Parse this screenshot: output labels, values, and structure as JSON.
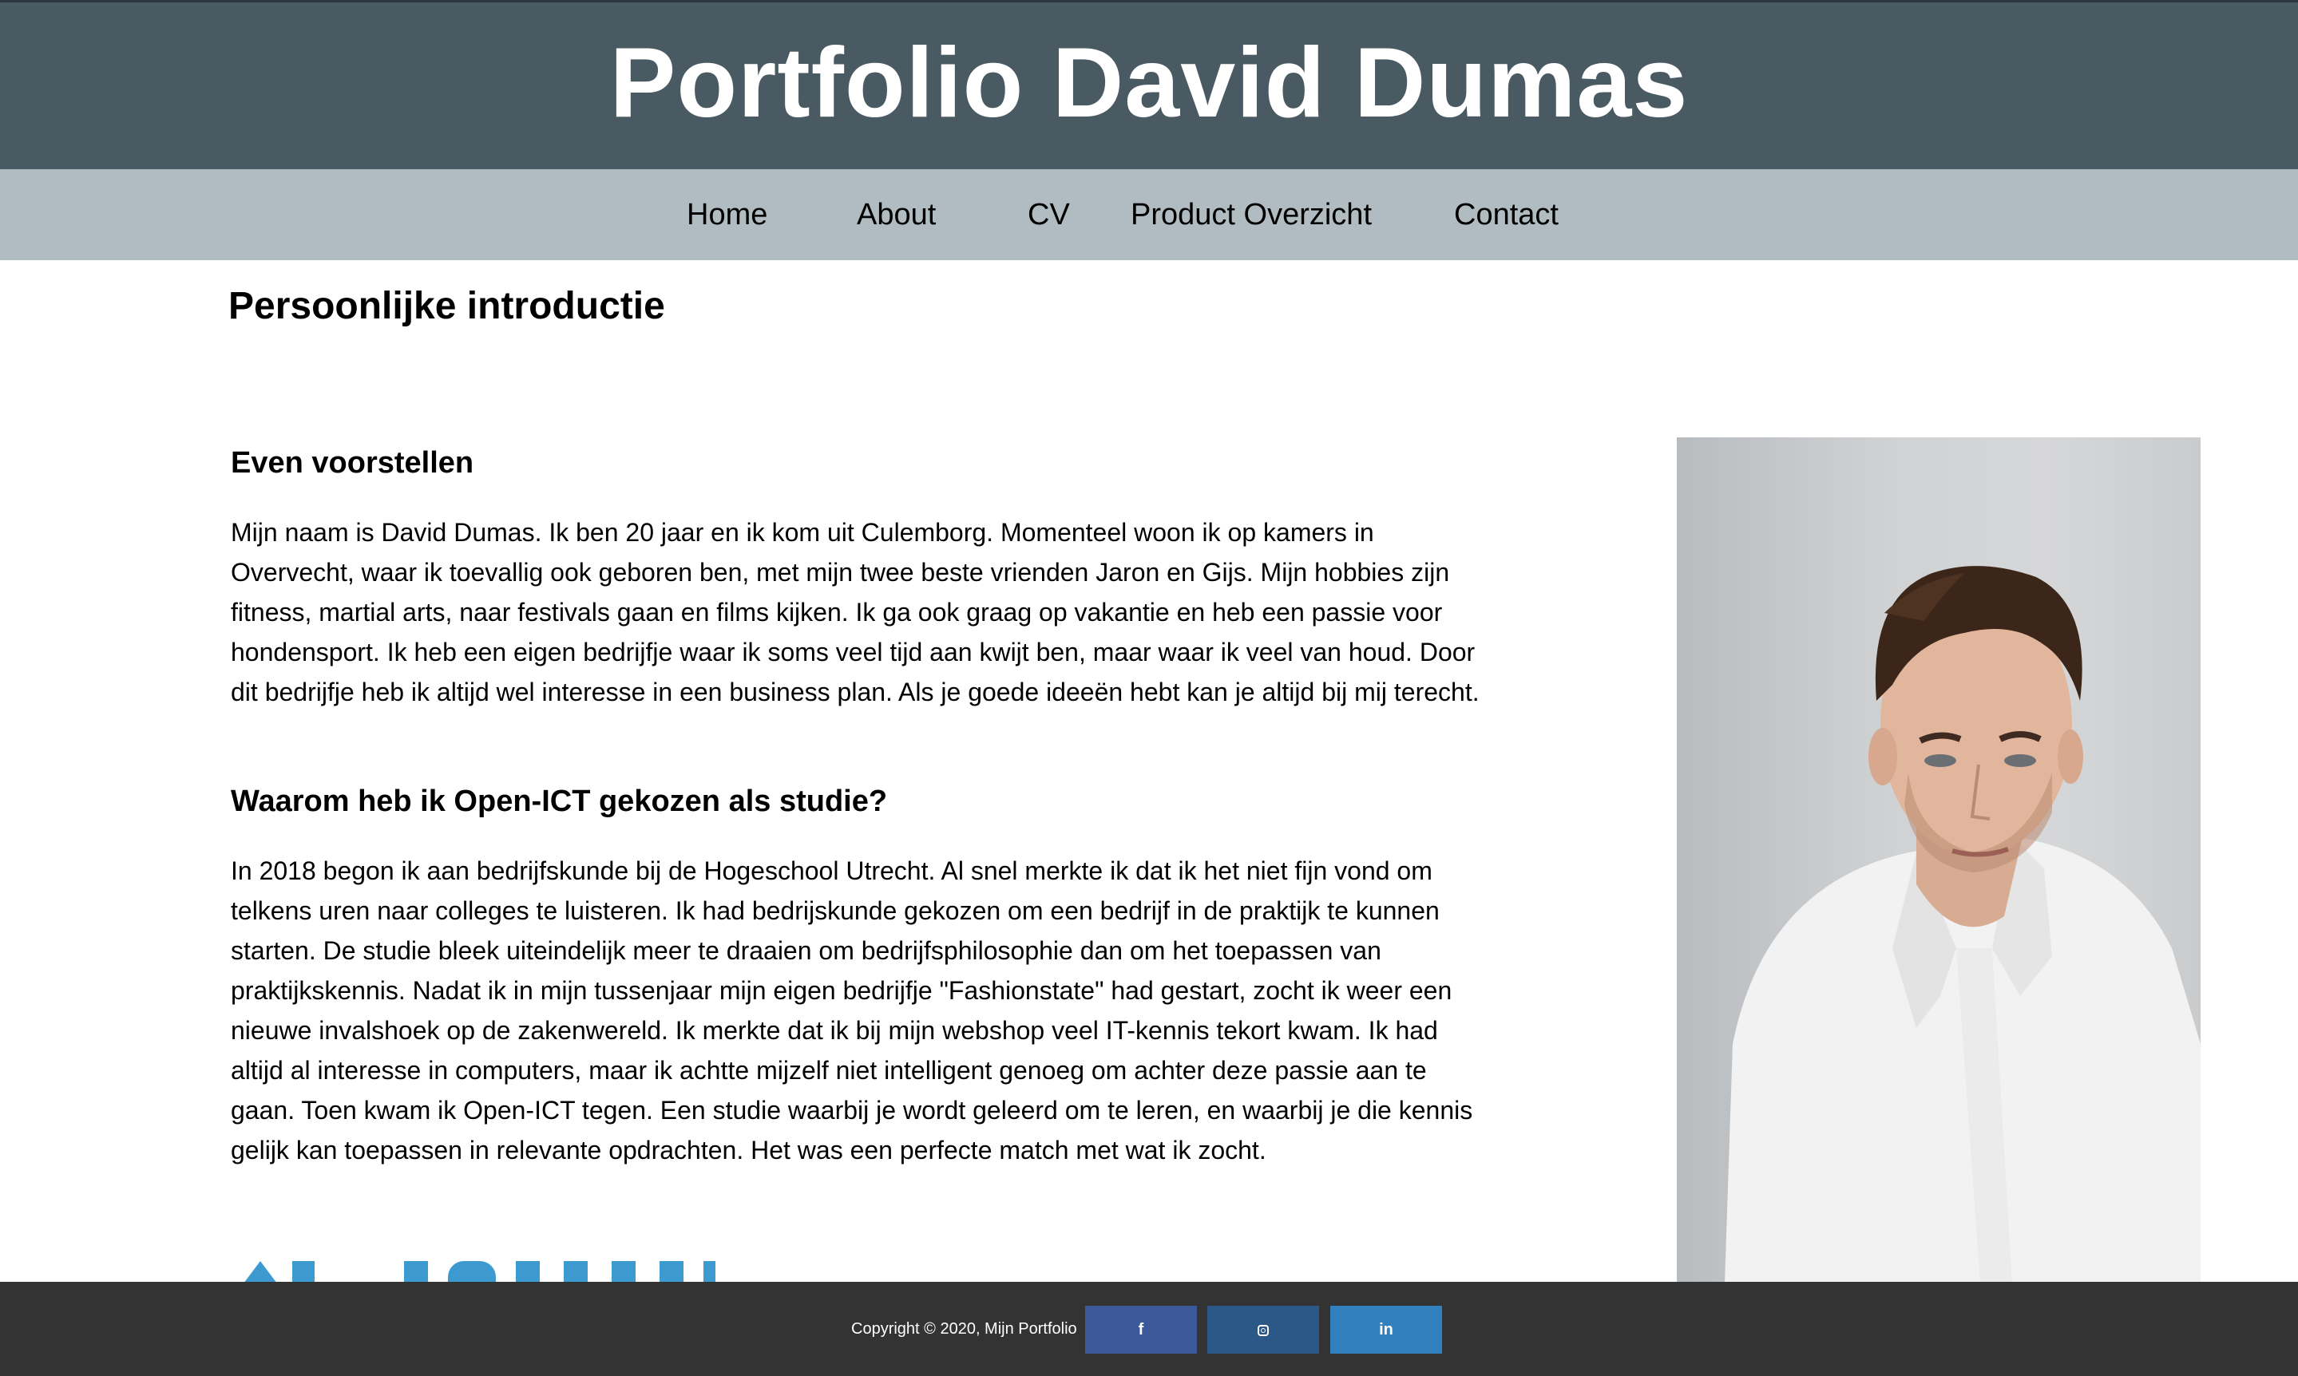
{
  "header": {
    "title": "Portfolio David Dumas"
  },
  "nav": {
    "items": [
      {
        "label": "Home"
      },
      {
        "label": "About"
      },
      {
        "label": "CV"
      },
      {
        "label": "Product Overzicht"
      },
      {
        "label": "Contact"
      }
    ]
  },
  "main": {
    "section_title": "Persoonlijke introductie",
    "intro_heading": "Even voorstellen",
    "intro_text": "Mijn naam is David Dumas. Ik ben 20 jaar en ik kom uit Culemborg. Momenteel woon ik op kamers in Overvecht, waar ik toevallig ook geboren ben, met mijn twee beste vrienden Jaron en Gijs. Mijn hobbies zijn fitness, martial arts, naar festivals gaan en films kijken. Ik ga ook graag op vakantie en heb een passie voor hondensport. Ik heb een eigen bedrijfje waar ik soms veel tijd aan kwijt ben, maar waar ik veel van houd. Door dit bedrijfje heb ik altijd wel interesse in een business plan. Als je goede ideeën hebt kan je altijd bij mij terecht.",
    "why_heading": "Waarom heb ik Open-ICT gekozen als studie?",
    "why_text": "In 2018 begon ik aan bedrijfskunde bij de Hogeschool Utrecht. Al snel merkte ik dat ik het niet fijn vond om telkens uren naar colleges te luisteren. Ik had bedrijskunde gekozen om een bedrijf in de praktijk te kunnen starten. De studie bleek uiteindelijk meer te draaien om bedrijfsphilosophie dan om het toepassen van praktijkskennis. Nadat ik in mijn tussenjaar mijn eigen bedrijfje \"Fashionstate\" had gestart, zocht ik weer een nieuwe invalshoek op de zakenwereld. Ik merkte dat ik bij mijn webshop veel IT-kennis tekort kwam. Ik had altijd al interesse in computers, maar ik achtte mijzelf niet intelligent genoeg om achter deze passie aan te gaan. Toen kwam ik Open-ICT tegen. Een studie waarbij je wordt geleerd om te leren, en waarbij je die kennis gelijk kan toepassen in relevante opdrachten. Het was een perfecte match met wat ik zocht."
  },
  "footer": {
    "copyright": "Copyright © 2020, Mijn Portfolio",
    "social": [
      {
        "name": "facebook",
        "glyph": "f",
        "color": "#3b5998"
      },
      {
        "name": "instagram",
        "glyph": "",
        "color": "#2c5887"
      },
      {
        "name": "linkedin",
        "glyph": "in",
        "color": "#3281be"
      }
    ]
  },
  "colors": {
    "header_bg": "#4a5a63",
    "nav_bg": "#b1bcc2",
    "footer_bg": "#333333",
    "logo_blue": "#3d9ad1"
  }
}
